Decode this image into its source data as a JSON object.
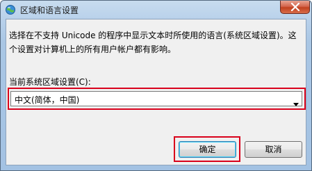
{
  "window": {
    "title": "区域和语言设置",
    "close_icon": "close-icon",
    "app_icon": "region-language-icon"
  },
  "content": {
    "description": "选择在不支持 Unicode 的程序中显示文本时所使用的语言(系统区域设置)。这个设置对计算机上的所有用户帐户都有影响。",
    "locale_label": "当前系统区域设置(C):",
    "locale_value": "中文(简体，中国)",
    "dropdown_icon": "chevron-down-icon"
  },
  "buttons": {
    "ok_label": "确定",
    "cancel_label": "取消"
  },
  "highlight_color": "#d9001b"
}
